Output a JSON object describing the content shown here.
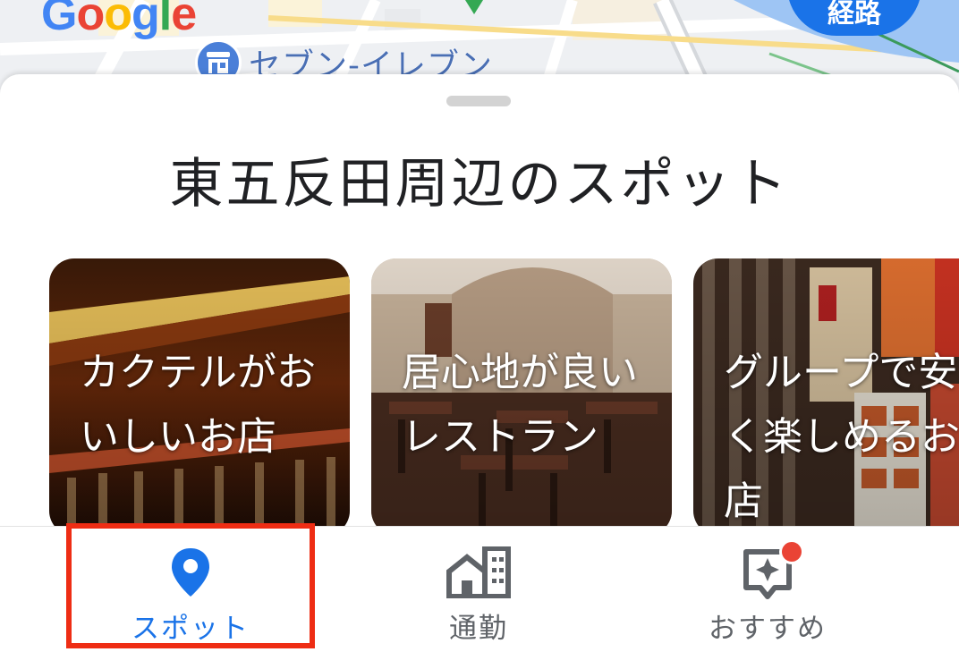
{
  "map": {
    "logo_text": "Google",
    "logo_letters": [
      "G",
      "o",
      "o",
      "g",
      "l",
      "e"
    ],
    "logo_colors": [
      "#4285f4",
      "#ea4335",
      "#fbbc05",
      "#4285f4",
      "#34a853",
      "#ea4335"
    ],
    "poi_label": "セブン-イレブン",
    "poi_icon": "convenience-store-icon",
    "route_button_label": "経路"
  },
  "sheet": {
    "title": "東五反田周辺のスポット",
    "cards": [
      {
        "label": "カクテルがおいしいお店"
      },
      {
        "label": "居心地が良いレストラン"
      },
      {
        "label": "グループで安く楽しめるお店"
      }
    ]
  },
  "bottom_nav": {
    "items": [
      {
        "label": "スポット",
        "icon": "location-pin-icon",
        "active": true
      },
      {
        "label": "通勤",
        "icon": "commute-building-icon",
        "active": false
      },
      {
        "label": "おすすめ",
        "icon": "sparkle-chat-icon",
        "active": false,
        "notification": true
      }
    ]
  },
  "colors": {
    "accent": "#1a73e8",
    "highlight_box": "#ee2d14",
    "notification_dot": "#ea4335"
  }
}
